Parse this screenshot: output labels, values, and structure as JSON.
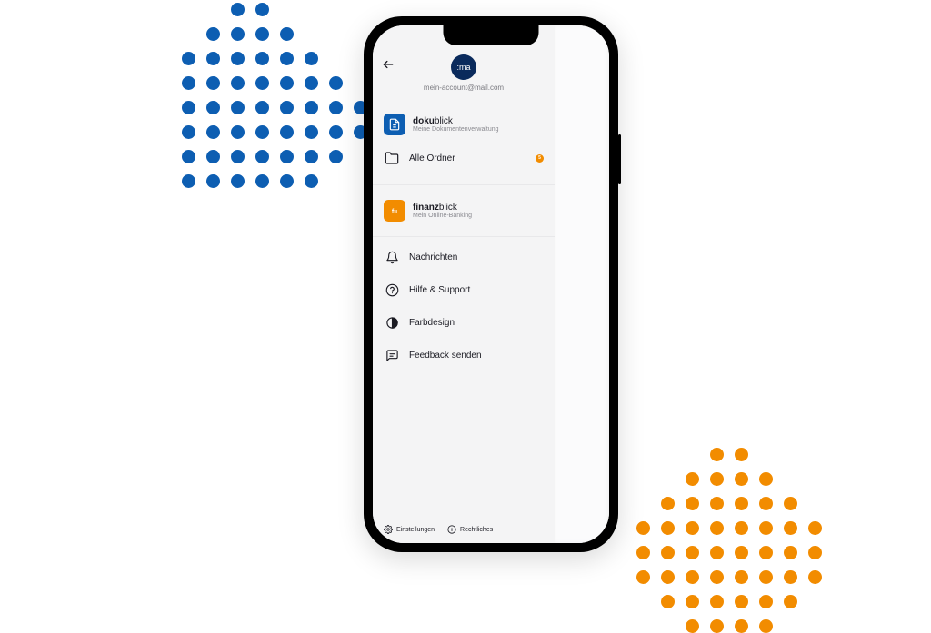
{
  "account": {
    "avatar_text": ":ma",
    "email": "mein-account@mail.com"
  },
  "apps": {
    "dokublick": {
      "title_bold": "doku",
      "title_thin": "blick",
      "subtitle": "Meine Dokumentenverwaltung",
      "folder_label": "Alle Ordner",
      "folder_badge": "5"
    },
    "finanzblick": {
      "title_bold": "finanz",
      "title_thin": "blick",
      "subtitle": "Mein Online-Banking"
    }
  },
  "menu": {
    "nachrichten": "Nachrichten",
    "hilfe": "Hilfe & Support",
    "farbdesign": "Farbdesign",
    "feedback": "Feedback senden"
  },
  "footer": {
    "einstellungen": "Einstellungen",
    "rechtliches": "Rechtliches"
  },
  "colors": {
    "blue": "#0d5eb2",
    "orange": "#f28c00",
    "dark_navy": "#0a2a5c"
  }
}
